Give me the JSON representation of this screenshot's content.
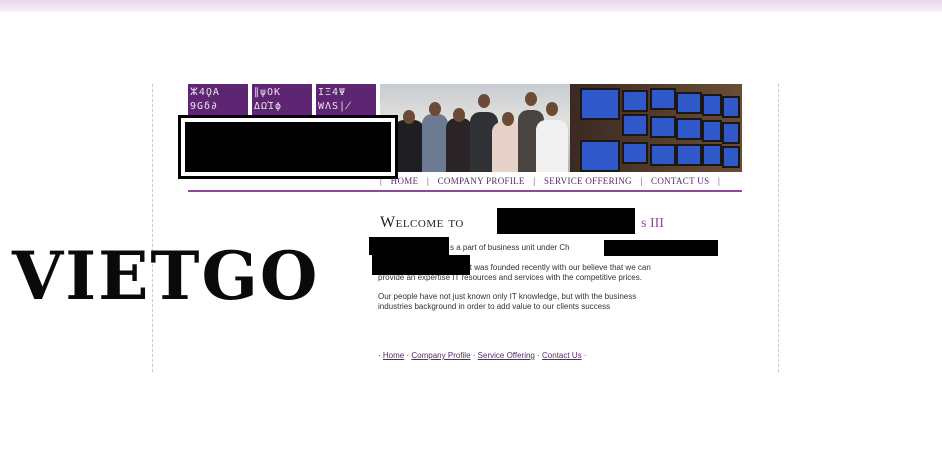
{
  "banner": {
    "glyph_rows": [
      [
        "ⵣ4ϘA",
        "∥ψOK",
        "IΞ4Ψ"
      ],
      [
        "9Gδ∂",
        "ΔΩΊϕ",
        "WΛS∤"
      ]
    ]
  },
  "nav": {
    "items": [
      "HOME",
      "COMPANY PROFILE",
      "SERVICE OFFERING",
      "CONTACT US"
    ],
    "separator": "|"
  },
  "content": {
    "welcome_prefix": "Welcome to",
    "welcome_tail": "s III",
    "para1_line1": "s a part of business unit under Ch",
    "para1_line2": "it was founded recently with our believe that we can",
    "para1_line3": "provide an expertise IT resources and services with the competitive prices.",
    "para2_line1": "Our people have not just known only IT knowledge, but with the business",
    "para2_line2": "industries background in order to add value to our clients success"
  },
  "footer": {
    "links": [
      "Home",
      "Company Profile",
      "Service Offering",
      "Contact Us"
    ],
    "separator": "·"
  },
  "watermark": {
    "text": "VIETGO"
  }
}
